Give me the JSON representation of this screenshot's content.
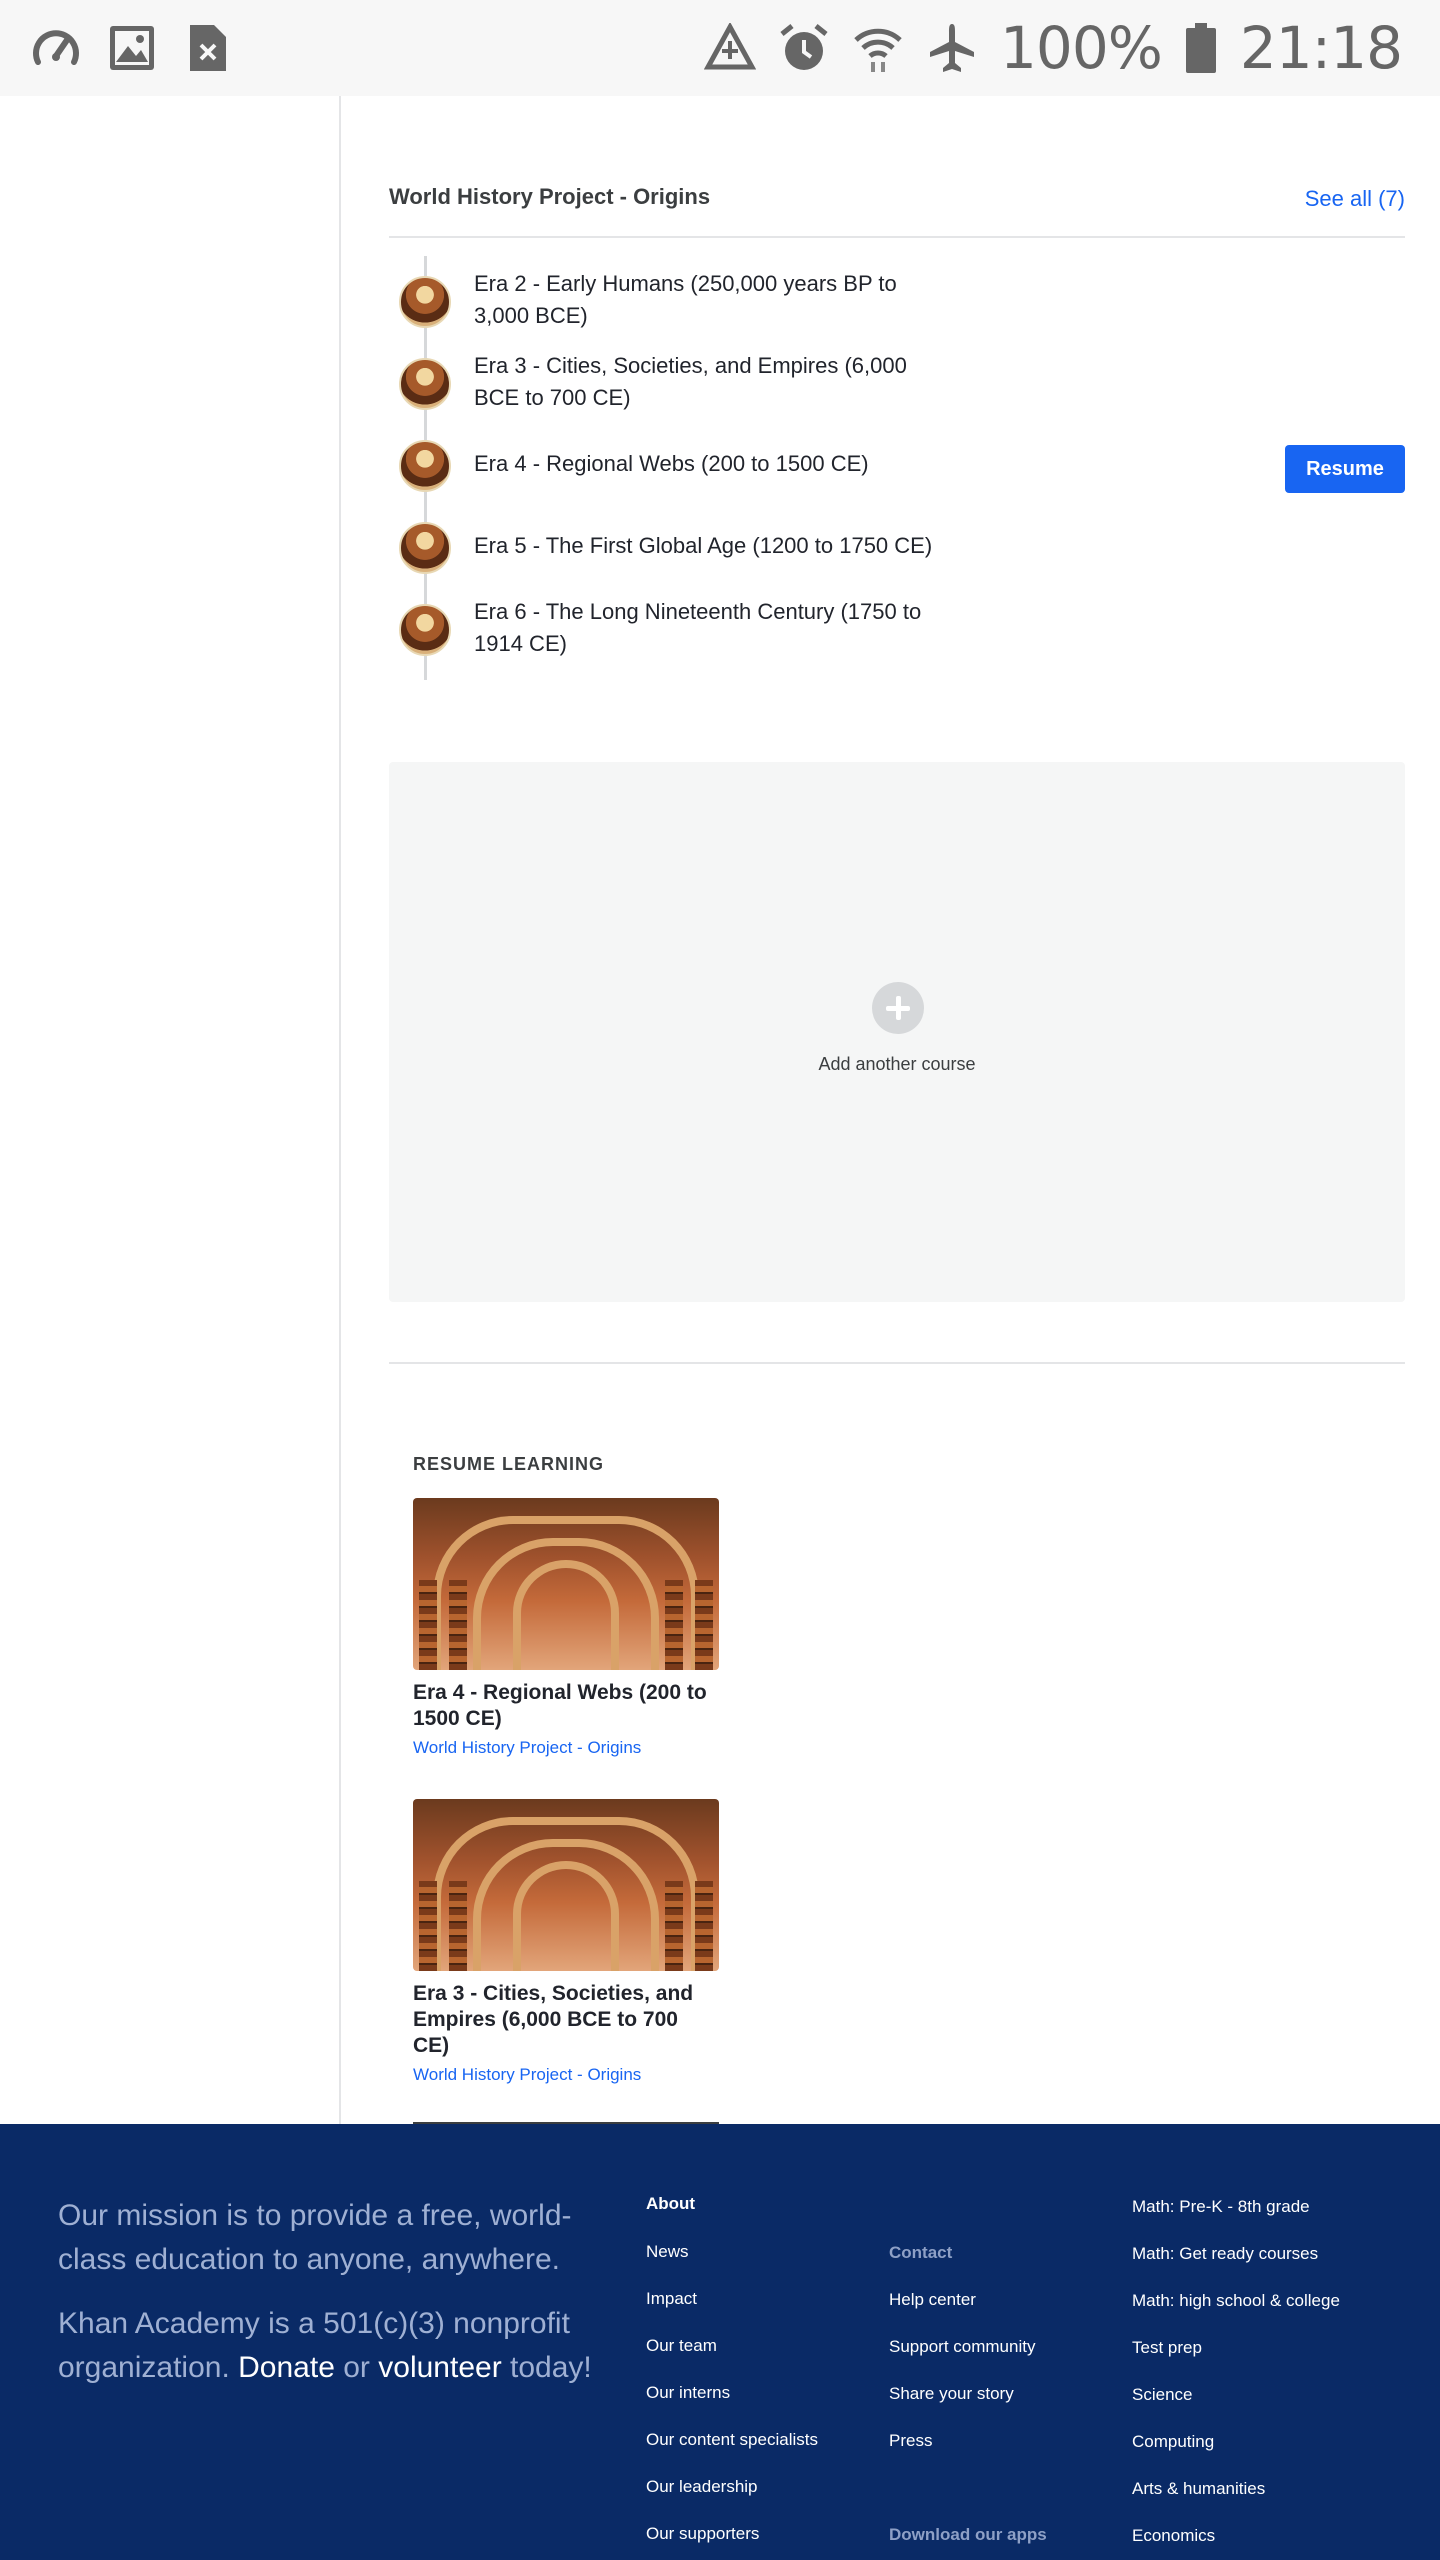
{
  "status_bar": {
    "left_icons": [
      "speedometer-icon",
      "image-icon",
      "file-close-icon"
    ],
    "right_icons": [
      "data-saver-icon",
      "alarm-icon",
      "wifi-icon",
      "airplane-icon",
      "battery-icon"
    ],
    "battery": "100%",
    "time": "21:18"
  },
  "course": {
    "title": "World History Project - Origins",
    "see_all": "See all (7)",
    "units": [
      {
        "title": "Era 2 - Early Humans (250,000 years BP to 3,000 BCE)"
      },
      {
        "title": "Era 3 - Cities, Societies, and Empires (6,000 BCE to 700 CE)"
      },
      {
        "title": "Era 4 - Regional Webs (200 to 1500 CE)",
        "action": "Resume"
      },
      {
        "title": "Era 5 - The First Global Age (1200 to 1750 CE)"
      },
      {
        "title": "Era 6 - The Long Nineteenth Century (1750 to 1914 CE)"
      }
    ]
  },
  "add_course": {
    "label": "Add another course"
  },
  "resume_learning": {
    "heading": "RESUME LEARNING",
    "cards": [
      {
        "title": "Era 4 - Regional Webs (200 to 1500 CE)",
        "course": "World History Project - Origins"
      },
      {
        "title": "Era 3 - Cities, Societies, and Empires (6,000 BCE to 700 CE)",
        "course": "World History Project - Origins"
      }
    ]
  },
  "footer": {
    "mission_1": "Our mission is to provide a free, world-class education to anyone, anywhere.",
    "mission_2_pre": "Khan Academy is a 501(c)(3) nonprofit organization.",
    "donate": "Donate",
    "or": "or",
    "volunteer": "volunteer",
    "today": "today!",
    "about": {
      "heading": "About",
      "links": [
        "News",
        "Impact",
        "Our team",
        "Our interns",
        "Our content specialists",
        "Our leadership",
        "Our supporters"
      ]
    },
    "contact": {
      "heading": "Contact",
      "links": [
        "Help center",
        "Support community",
        "Share your story",
        "Press"
      ],
      "apps_heading": "Download our apps"
    },
    "subjects": [
      "Math: Pre-K - 8th grade",
      "Math: Get ready courses",
      "Math: high school & college",
      "Test prep",
      "Science",
      "Computing",
      "Arts & humanities",
      "Economics"
    ]
  }
}
